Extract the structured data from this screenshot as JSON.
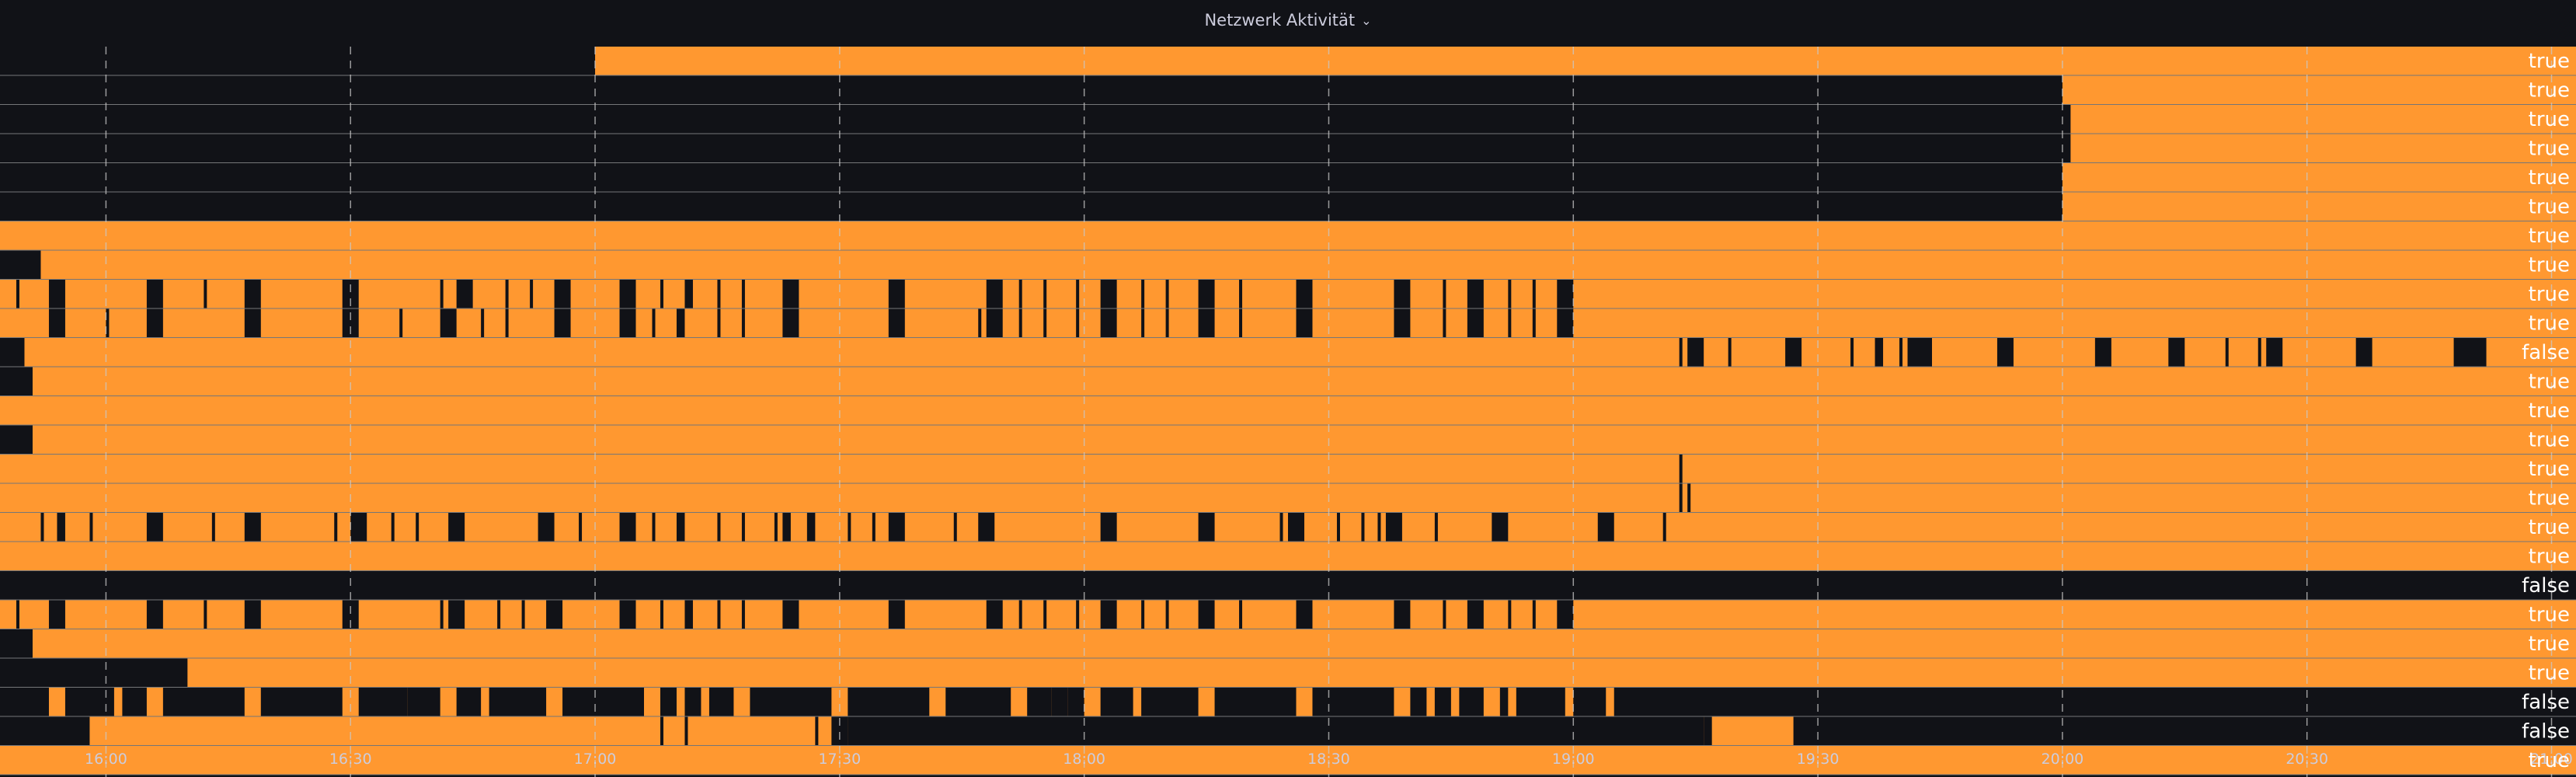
{
  "panel": {
    "title": "Netzwerk Aktivität",
    "menu_icon": "chevron-down-icon"
  },
  "colors": {
    "background": "#111217",
    "true": "#ff9830",
    "false": "#111217",
    "grid": "#c8c8c8",
    "axis_text": "#ccccdc",
    "state_text": "#ffffff"
  },
  "chart_data": {
    "type": "state-timeline",
    "title": "Netzwerk Aktivität",
    "x_range": [
      "15:47",
      "21:03"
    ],
    "x_ticks": [
      "16:00",
      "16:30",
      "17:00",
      "17:30",
      "18:00",
      "18:30",
      "19:00",
      "19:30",
      "20:00",
      "20:30",
      "21:00"
    ],
    "states": {
      "true": "orange",
      "false": "black"
    },
    "rows": [
      {
        "value": "true",
        "off": [
          [
            "15:47",
            "17:00"
          ]
        ]
      },
      {
        "value": "true",
        "off": [
          [
            "15:47",
            "20:00"
          ]
        ]
      },
      {
        "value": "true",
        "off": [
          [
            "15:47",
            "20:01"
          ]
        ]
      },
      {
        "value": "true",
        "off": [
          [
            "15:47",
            "20:01"
          ]
        ]
      },
      {
        "value": "true",
        "off": [
          [
            "15:47",
            "20:00"
          ]
        ]
      },
      {
        "value": "true",
        "off": [
          [
            "15:47",
            "20:00"
          ]
        ]
      },
      {
        "value": "true",
        "off": []
      },
      {
        "value": "true",
        "off": [
          [
            "15:47",
            "15:52"
          ]
        ]
      },
      {
        "value": "true",
        "off": [
          [
            "15:49",
            "15:49"
          ],
          [
            "15:53",
            "15:55"
          ],
          [
            "16:05",
            "16:07"
          ],
          [
            "16:12",
            "16:12"
          ],
          [
            "16:17",
            "16:19"
          ],
          [
            "16:29",
            "16:31"
          ],
          [
            "16:41",
            "16:41"
          ],
          [
            "16:43",
            "16:45"
          ],
          [
            "16:49",
            "16:49"
          ],
          [
            "16:52",
            "16:52"
          ],
          [
            "16:55",
            "16:57"
          ],
          [
            "17:03",
            "17:05"
          ],
          [
            "17:08",
            "17:08"
          ],
          [
            "17:11",
            "17:12"
          ],
          [
            "17:15",
            "17:15"
          ],
          [
            "17:18",
            "17:18"
          ],
          [
            "17:23",
            "17:25"
          ],
          [
            "17:36",
            "17:38"
          ],
          [
            "17:48",
            "17:50"
          ],
          [
            "17:52",
            "17:52"
          ],
          [
            "17:55",
            "17:55"
          ],
          [
            "17:59",
            "17:59"
          ],
          [
            "18:02",
            "18:04"
          ],
          [
            "18:07",
            "18:07"
          ],
          [
            "18:10",
            "18:10"
          ],
          [
            "18:14",
            "18:16"
          ],
          [
            "18:19",
            "18:19"
          ],
          [
            "18:26",
            "18:28"
          ],
          [
            "18:38",
            "18:40"
          ],
          [
            "18:44",
            "18:44"
          ],
          [
            "18:47",
            "18:49"
          ],
          [
            "18:52",
            "18:52"
          ],
          [
            "18:55",
            "18:55"
          ],
          [
            "18:58",
            "19:00"
          ]
        ]
      },
      {
        "value": "true",
        "off": [
          [
            "15:53",
            "15:55"
          ],
          [
            "15:60",
            "15:60"
          ],
          [
            "16:05",
            "16:07"
          ],
          [
            "16:17",
            "16:19"
          ],
          [
            "16:29",
            "16:31"
          ],
          [
            "16:36",
            "16:36"
          ],
          [
            "16:41",
            "16:43"
          ],
          [
            "16:46",
            "16:46"
          ],
          [
            "16:49",
            "16:49"
          ],
          [
            "16:55",
            "16:57"
          ],
          [
            "17:03",
            "17:05"
          ],
          [
            "17:07",
            "17:07"
          ],
          [
            "17:10",
            "17:11"
          ],
          [
            "17:15",
            "17:15"
          ],
          [
            "17:18",
            "17:18"
          ],
          [
            "17:23",
            "17:25"
          ],
          [
            "17:36",
            "17:38"
          ],
          [
            "17:47",
            "17:47"
          ],
          [
            "17:48",
            "17:50"
          ],
          [
            "17:52",
            "17:52"
          ],
          [
            "17:55",
            "17:55"
          ],
          [
            "17:59",
            "17:59"
          ],
          [
            "18:02",
            "18:04"
          ],
          [
            "18:07",
            "18:07"
          ],
          [
            "18:10",
            "18:10"
          ],
          [
            "18:14",
            "18:16"
          ],
          [
            "18:19",
            "18:19"
          ],
          [
            "18:26",
            "18:28"
          ],
          [
            "18:38",
            "18:40"
          ],
          [
            "18:44",
            "18:44"
          ],
          [
            "18:47",
            "18:49"
          ],
          [
            "18:52",
            "18:52"
          ],
          [
            "18:55",
            "18:55"
          ],
          [
            "18:58",
            "19:00"
          ]
        ]
      },
      {
        "value": "false",
        "off": [
          [
            "15:47",
            "15:50"
          ],
          [
            "19:13",
            "19:13"
          ],
          [
            "19:14",
            "19:16"
          ],
          [
            "19:19",
            "19:19"
          ],
          [
            "19:26",
            "19:28"
          ],
          [
            "19:34",
            "19:34"
          ],
          [
            "19:37",
            "19:38"
          ],
          [
            "19:40",
            "19:40"
          ],
          [
            "19:41",
            "19:44"
          ],
          [
            "19:52",
            "19:54"
          ],
          [
            "20:04",
            "20:06"
          ],
          [
            "20:13",
            "20:15"
          ],
          [
            "20:20",
            "20:20"
          ],
          [
            "20:24",
            "20:24"
          ],
          [
            "20:25",
            "20:27"
          ],
          [
            "20:36",
            "20:38"
          ],
          [
            "20:48",
            "20:52"
          ]
        ]
      },
      {
        "value": "true",
        "off": [
          [
            "15:47",
            "15:51"
          ]
        ]
      },
      {
        "value": "true",
        "off": []
      },
      {
        "value": "true",
        "off": [
          [
            "15:47",
            "15:51"
          ]
        ]
      },
      {
        "value": "true",
        "off": [
          [
            "19:13",
            "19:13"
          ]
        ]
      },
      {
        "value": "true",
        "off": [
          [
            "19:13",
            "19:13"
          ],
          [
            "19:14",
            "19:14"
          ]
        ]
      },
      {
        "value": "true",
        "off": [
          [
            "15:52",
            "15:52"
          ],
          [
            "15:54",
            "15:55"
          ],
          [
            "15:58",
            "15:58"
          ],
          [
            "16:05",
            "16:07"
          ],
          [
            "16:13",
            "16:13"
          ],
          [
            "16:17",
            "16:19"
          ],
          [
            "16:28",
            "16:28"
          ],
          [
            "16:30",
            "16:32"
          ],
          [
            "16:35",
            "16:35"
          ],
          [
            "16:38",
            "16:38"
          ],
          [
            "16:42",
            "16:44"
          ],
          [
            "16:53",
            "16:55"
          ],
          [
            "16:58",
            "16:58"
          ],
          [
            "17:03",
            "17:05"
          ],
          [
            "17:07",
            "17:07"
          ],
          [
            "17:10",
            "17:11"
          ],
          [
            "17:15",
            "17:15"
          ],
          [
            "17:18",
            "17:18"
          ],
          [
            "17:22",
            "17:22"
          ],
          [
            "17:23",
            "17:24"
          ],
          [
            "17:26",
            "17:27"
          ],
          [
            "17:31",
            "17:31"
          ],
          [
            "17:34",
            "17:34"
          ],
          [
            "17:36",
            "17:38"
          ],
          [
            "17:44",
            "17:44"
          ],
          [
            "17:47",
            "17:49"
          ],
          [
            "18:02",
            "18:04"
          ],
          [
            "18:14",
            "18:16"
          ],
          [
            "18:24",
            "18:24"
          ],
          [
            "18:25",
            "18:27"
          ],
          [
            "18:31",
            "18:31"
          ],
          [
            "18:34",
            "18:34"
          ],
          [
            "18:36",
            "18:36"
          ],
          [
            "18:37",
            "18:39"
          ],
          [
            "18:43",
            "18:43"
          ],
          [
            "18:50",
            "18:52"
          ],
          [
            "19:03",
            "19:05"
          ],
          [
            "19:11",
            "19:11"
          ]
        ]
      },
      {
        "value": "true",
        "off": []
      },
      {
        "value": "false",
        "off": [
          [
            "15:47",
            "21:03"
          ]
        ]
      },
      {
        "value": "true",
        "off": [
          [
            "15:49",
            "15:49"
          ],
          [
            "15:53",
            "15:55"
          ],
          [
            "16:05",
            "16:07"
          ],
          [
            "16:12",
            "16:12"
          ],
          [
            "16:17",
            "16:19"
          ],
          [
            "16:29",
            "16:31"
          ],
          [
            "16:41",
            "16:41"
          ],
          [
            "16:42",
            "16:44"
          ],
          [
            "16:48",
            "16:48"
          ],
          [
            "16:51",
            "16:51"
          ],
          [
            "16:54",
            "16:56"
          ],
          [
            "17:03",
            "17:05"
          ],
          [
            "17:08",
            "17:08"
          ],
          [
            "17:11",
            "17:12"
          ],
          [
            "17:15",
            "17:15"
          ],
          [
            "17:18",
            "17:18"
          ],
          [
            "17:23",
            "17:25"
          ],
          [
            "17:36",
            "17:38"
          ],
          [
            "17:48",
            "17:50"
          ],
          [
            "17:52",
            "17:52"
          ],
          [
            "17:55",
            "17:55"
          ],
          [
            "17:59",
            "17:59"
          ],
          [
            "18:02",
            "18:04"
          ],
          [
            "18:07",
            "18:07"
          ],
          [
            "18:10",
            "18:10"
          ],
          [
            "18:14",
            "18:16"
          ],
          [
            "18:19",
            "18:19"
          ],
          [
            "18:26",
            "18:28"
          ],
          [
            "18:38",
            "18:40"
          ],
          [
            "18:44",
            "18:44"
          ],
          [
            "18:47",
            "18:49"
          ],
          [
            "18:52",
            "18:52"
          ],
          [
            "18:55",
            "18:55"
          ],
          [
            "18:58",
            "19:00"
          ]
        ]
      },
      {
        "value": "true",
        "off": [
          [
            "15:47",
            "15:51"
          ]
        ]
      },
      {
        "value": "true",
        "off": [
          [
            "15:47",
            "16:10"
          ]
        ]
      },
      {
        "value": "false",
        "off": [
          [
            "15:47",
            "15:53"
          ],
          [
            "15:55",
            "16:01"
          ],
          [
            "16:02",
            "16:05"
          ],
          [
            "16:07",
            "16:17"
          ],
          [
            "16:19",
            "16:29"
          ],
          [
            "16:31",
            "16:37"
          ],
          [
            "16:37",
            "16:41"
          ],
          [
            "16:43",
            "16:46"
          ],
          [
            "16:47",
            "16:54"
          ],
          [
            "16:56",
            "17:06"
          ],
          [
            "17:08",
            "17:10"
          ],
          [
            "17:11",
            "17:13"
          ],
          [
            "17:14",
            "17:17"
          ],
          [
            "17:19",
            "17:29"
          ],
          [
            "17:31",
            "17:41"
          ],
          [
            "17:43",
            "17:51"
          ],
          [
            "17:53",
            "17:56"
          ],
          [
            "17:56",
            "17:58"
          ],
          [
            "17:58",
            "18:00"
          ],
          [
            "18:02",
            "18:06"
          ],
          [
            "18:07",
            "18:14"
          ],
          [
            "18:16",
            "18:26"
          ],
          [
            "18:28",
            "18:38"
          ],
          [
            "18:40",
            "18:42"
          ],
          [
            "18:43",
            "18:45"
          ],
          [
            "18:46",
            "18:49"
          ],
          [
            "18:51",
            "18:52"
          ],
          [
            "18:53",
            "18:59"
          ],
          [
            "19:00",
            "19:04"
          ],
          [
            "19:05",
            "21:03"
          ]
        ]
      },
      {
        "value": "false",
        "off": [
          [
            "15:47",
            "15:58"
          ],
          [
            "17:08",
            "17:08"
          ],
          [
            "17:11",
            "17:11"
          ],
          [
            "17:27",
            "17:27"
          ],
          [
            "17:29",
            "17:31"
          ],
          [
            "17:31",
            "17:31"
          ],
          [
            "17:31",
            "19:16"
          ],
          [
            "19:16",
            "19:17"
          ],
          [
            "19:27",
            "21:03"
          ]
        ]
      },
      {
        "value": "true",
        "off": []
      }
    ]
  }
}
